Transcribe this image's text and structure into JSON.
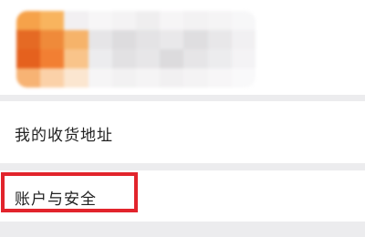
{
  "profile": {
    "avatar_redacted": true,
    "mosaic_colors": [
      [
        "#f6a24a",
        "#f8b45e",
        "#f2f0f2",
        "#f7f6f7",
        "#f4f3f4",
        "#efeeef",
        "#f6f5f6",
        "#f3f2f3",
        "#f5f4f5",
        "#f7f7f8"
      ],
      [
        "#e56a24",
        "#ef8a3a",
        "#f6b36a",
        "#e6e5e7",
        "#dddcde",
        "#e4e3e5",
        "#e9e8ea",
        "#dfdee0",
        "#e8e7e9",
        "#f1f0f2"
      ],
      [
        "#e5611e",
        "#f27f33",
        "#f9c48a",
        "#ececee",
        "#e2e1e3",
        "#e7e6e8",
        "#dcdbdd",
        "#e6e5e7",
        "#ececee",
        "#f4f3f5"
      ],
      [
        "#f7b374",
        "#fbd1a8",
        "#fbe6d0",
        "#f6f5f6",
        "#f2f1f2",
        "#f5f4f5",
        "#f1f0f1",
        "#f4f3f4",
        "#f7f6f7",
        "#f9f9fa"
      ]
    ]
  },
  "menu": {
    "shipping_address_label": "我的收货地址",
    "account_security_label": "账户与安全"
  },
  "highlight": {
    "color": "#e2242c",
    "target": "account-security"
  }
}
